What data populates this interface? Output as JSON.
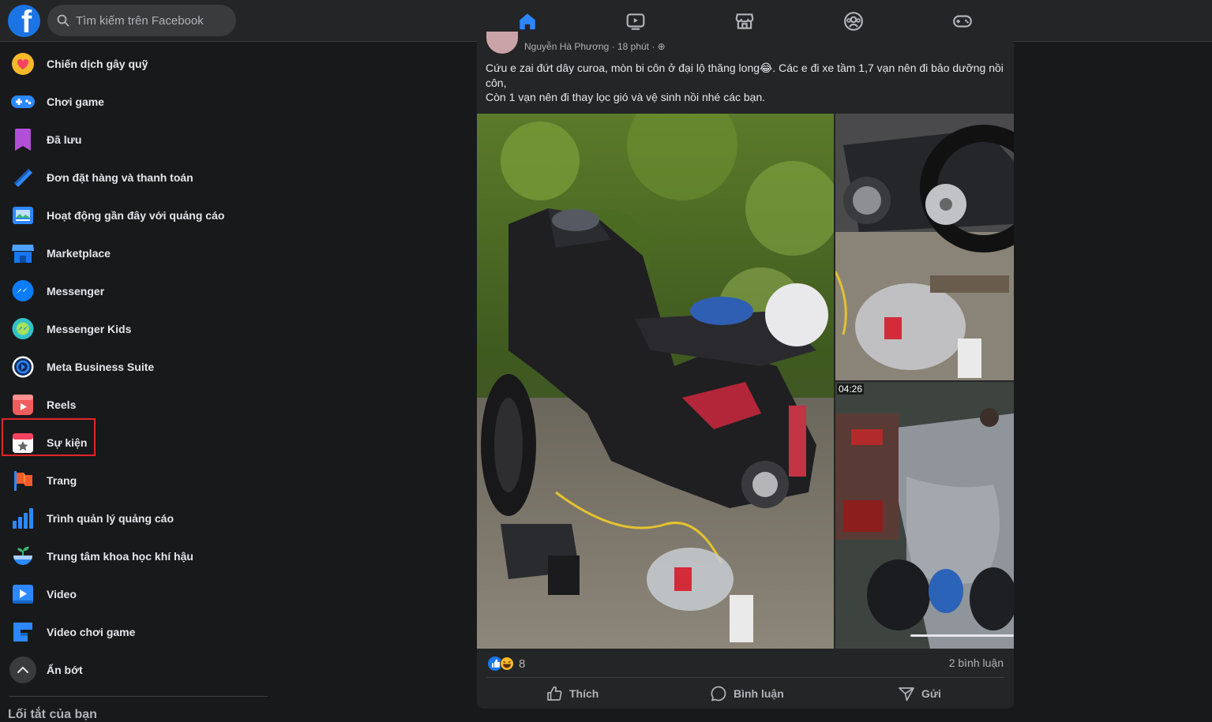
{
  "header": {
    "logo": "Facebook logo",
    "search_placeholder": "Tìm kiếm trên Facebook",
    "nav_tabs": [
      "home-icon",
      "watch-icon",
      "marketplace-icon",
      "groups-icon",
      "gaming-icon"
    ],
    "active_tab": "home-icon",
    "accent": "#2d88ff"
  },
  "sidebar": {
    "items": [
      {
        "label": "Chiến dịch gây quỹ",
        "icon": "fundraiser-icon"
      },
      {
        "label": "Chơi game",
        "icon": "gamepad-icon"
      },
      {
        "label": "Đã lưu",
        "icon": "bookmark-icon"
      },
      {
        "label": "Đơn đặt hàng và thanh toán",
        "icon": "payment-icon"
      },
      {
        "label": "Hoạt động gần đây với quảng cáo",
        "icon": "ad-activity-icon"
      },
      {
        "label": "Marketplace",
        "icon": "marketplace-icon"
      },
      {
        "label": "Messenger",
        "icon": "messenger-icon"
      },
      {
        "label": "Messenger Kids",
        "icon": "messenger-kids-icon"
      },
      {
        "label": "Meta Business Suite",
        "icon": "business-suite-icon"
      },
      {
        "label": "Reels",
        "icon": "reels-icon"
      },
      {
        "label": "Sự kiện",
        "icon": "events-icon"
      },
      {
        "label": "Trang",
        "icon": "pages-flag-icon"
      },
      {
        "label": "Trình quản lý quảng cáo",
        "icon": "ads-manager-icon"
      },
      {
        "label": "Trung tâm khoa học khí hậu",
        "icon": "climate-icon"
      },
      {
        "label": "Video",
        "icon": "video-icon"
      },
      {
        "label": "Video chơi game",
        "icon": "gaming-video-icon"
      },
      {
        "label": "Ẩn bớt",
        "icon": "chevron-up-icon"
      }
    ],
    "shortcuts_heading": "Lối tắt của bạn",
    "highlight_color": "#e0252b"
  },
  "post": {
    "author_meta": "Nguyễn Hà Phương · 18 phút · ⊕",
    "text_lines": [
      "Cứu e zai đứt dây curoa, mòn bi côn ở đại lộ thăng long😂. Các e đi xe tầm 1,7 vạn nên đi bảo dưỡng nồi côn,",
      "Còn 1 vạn nên đi thay lọc gió và vệ sinh nồi nhé các bạn."
    ],
    "video_time": "04:26",
    "reaction_count": "8",
    "comment_count": "2 bình luận",
    "actions": {
      "like": "Thích",
      "comment": "Bình luận",
      "share": "Gửi"
    }
  }
}
